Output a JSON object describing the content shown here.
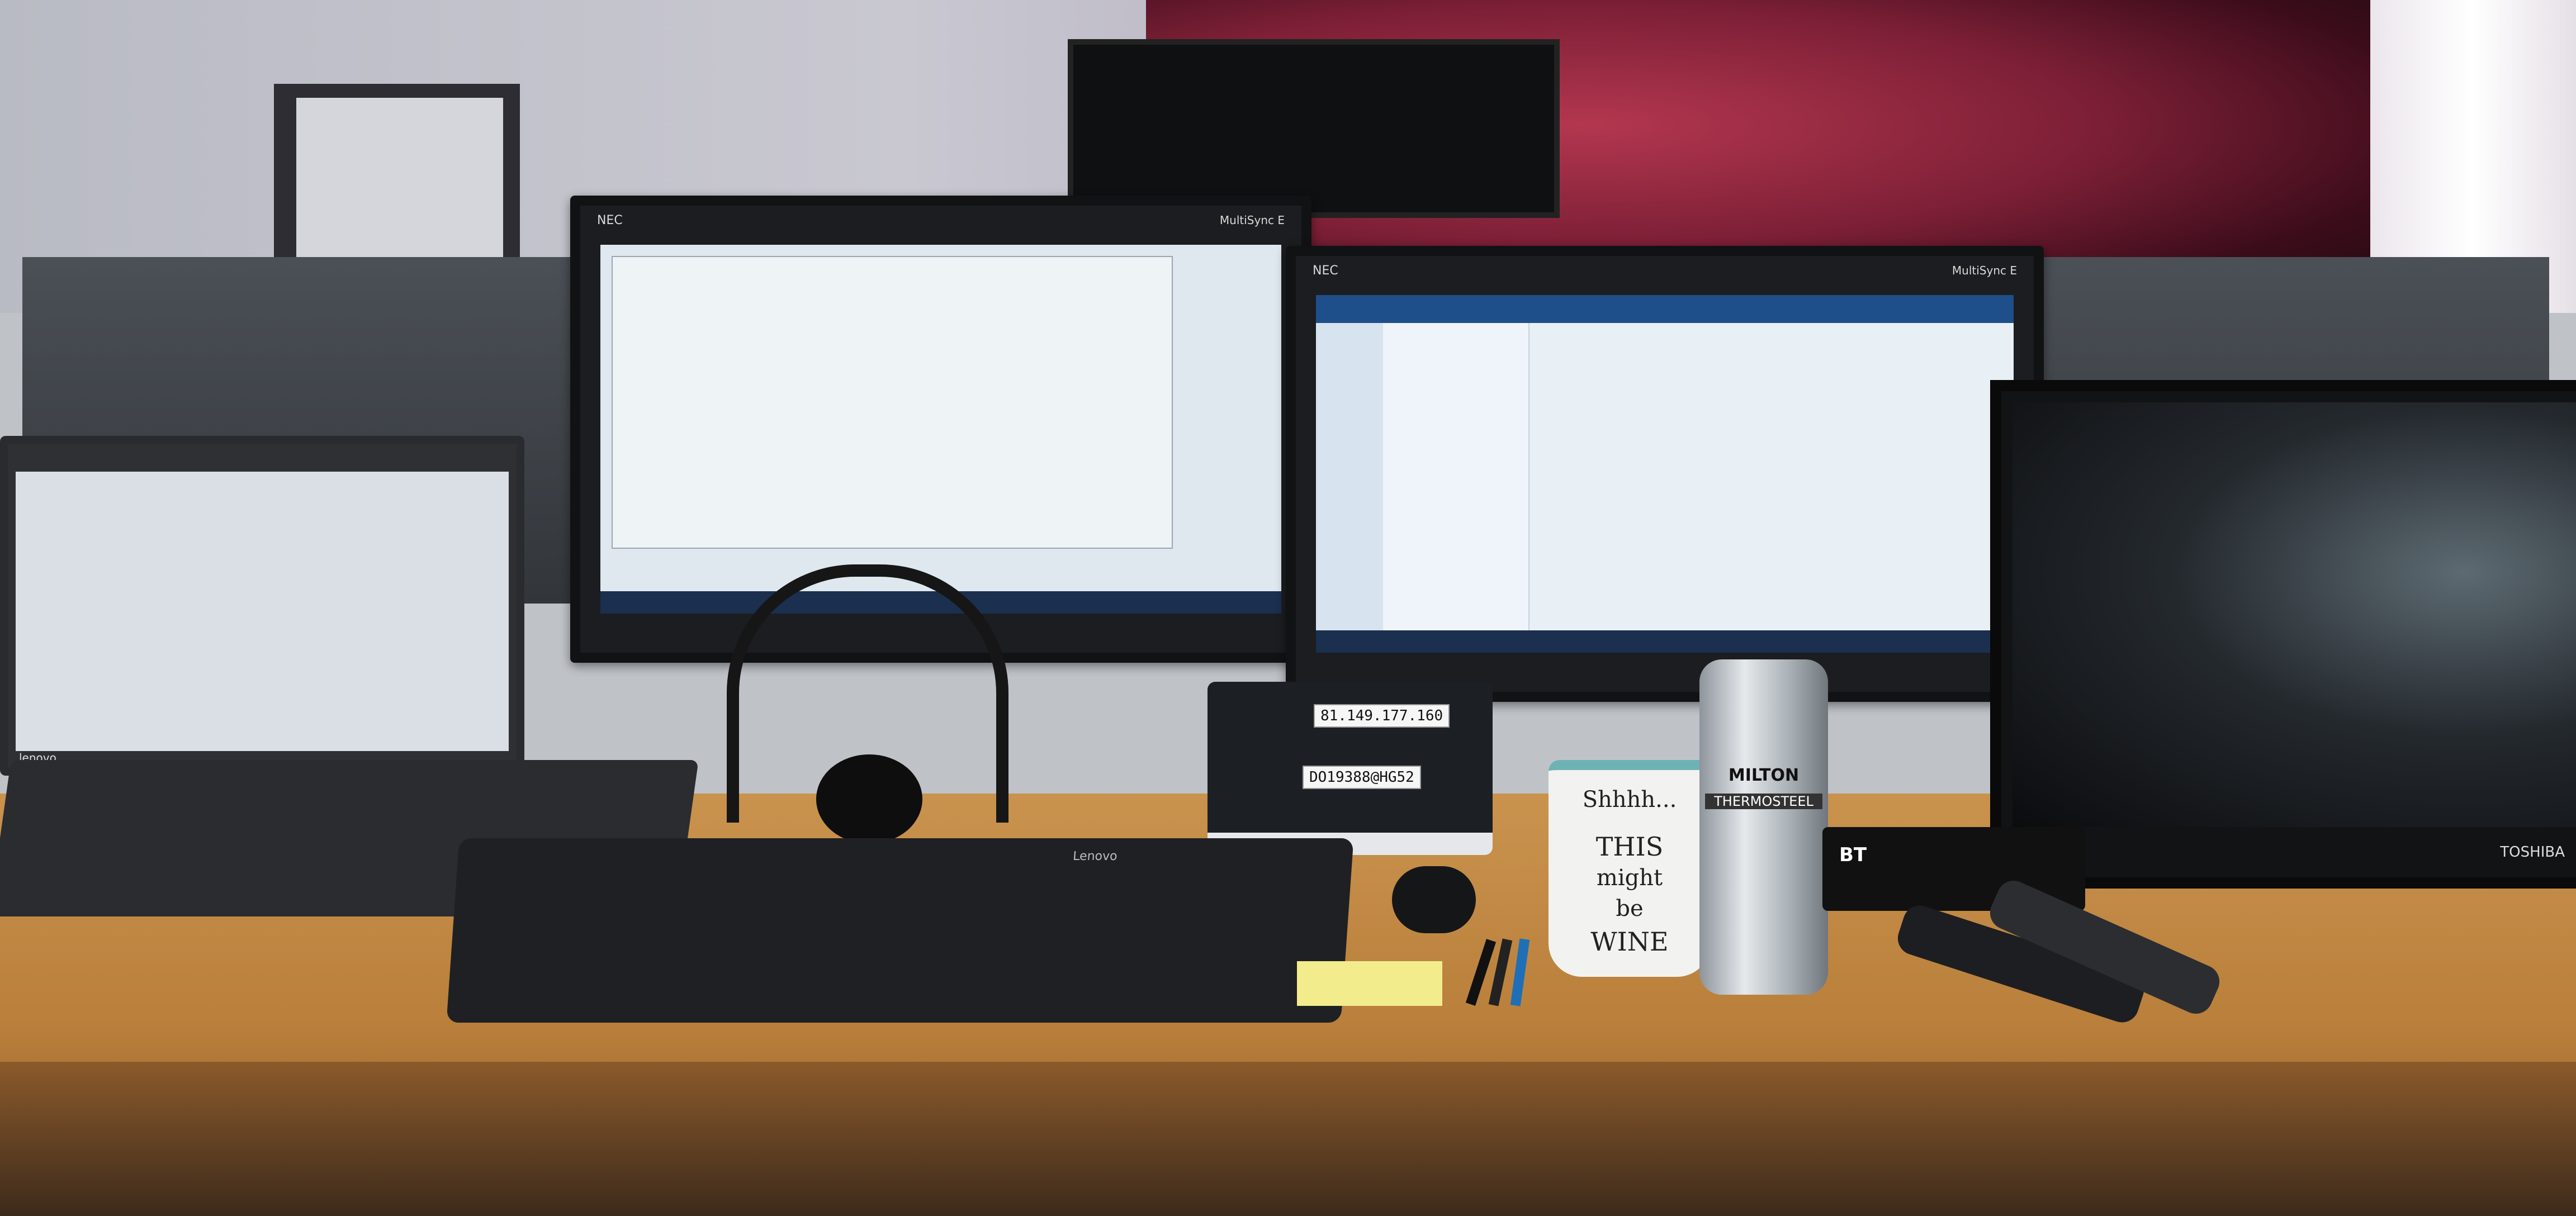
{
  "scene": {
    "description_visible_text": {
      "left_monitor_brand": "NEC",
      "left_monitor_model": "MultiSync E",
      "right_monitor_brand": "NEC",
      "right_monitor_model": "MultiSync E",
      "tv_brand": "TOSHIBA",
      "laptop_brand": "lenovo",
      "keyboard_brand": "Lenovo",
      "router_label_ip": "81.149.177.160",
      "router_label_id": "DO19388@HG52",
      "mug_text_line1": "Shhhh...",
      "mug_text_line2": "THIS",
      "mug_text_line3": "might",
      "mug_text_line4": "be",
      "mug_text_line5": "WINE",
      "flask_brand": "MILTON",
      "flask_model": "THERMOSTEEL",
      "bt_box_logo": "BT"
    }
  },
  "colors": {
    "desk": "#c18a45",
    "mug_rim": "#6db3b5",
    "sticky_note": "#f3ec8d"
  }
}
